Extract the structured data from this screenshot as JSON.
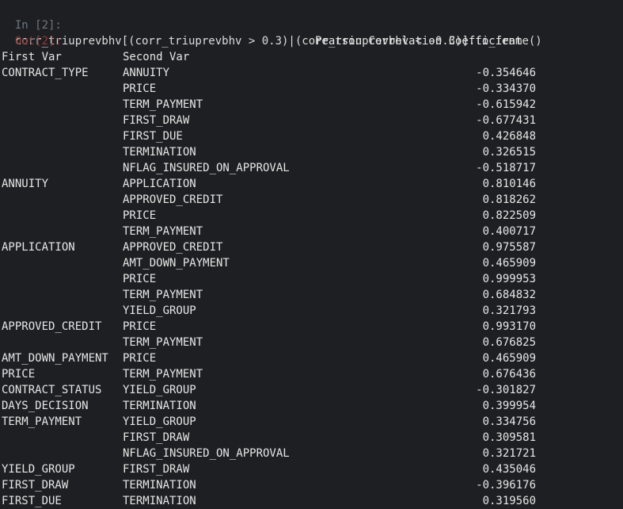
{
  "input": {
    "prompt": "In [2]:",
    "code": "corr_triuprevbhv[(corr_triuprevbhv > 0.3)|(corr_triuprevbhv < -0.3)].to_frame()"
  },
  "output": {
    "prompt": "Out[2]:",
    "column_header": "Pearson Correlation Coefficient",
    "index_headers": [
      "First Var",
      "Second Var"
    ],
    "rows": [
      {
        "first": "CONTRACT_TYPE",
        "second": "ANNUITY",
        "value": "-0.354646"
      },
      {
        "first": "",
        "second": "PRICE",
        "value": "-0.334370"
      },
      {
        "first": "",
        "second": "TERM_PAYMENT",
        "value": "-0.615942"
      },
      {
        "first": "",
        "second": "FIRST_DRAW",
        "value": "-0.677431"
      },
      {
        "first": "",
        "second": "FIRST_DUE",
        "value": "0.426848"
      },
      {
        "first": "",
        "second": "TERMINATION",
        "value": "0.326515"
      },
      {
        "first": "",
        "second": "NFLAG_INSURED_ON_APPROVAL",
        "value": "-0.518717"
      },
      {
        "first": "ANNUITY",
        "second": "APPLICATION",
        "value": "0.810146"
      },
      {
        "first": "",
        "second": "APPROVED_CREDIT",
        "value": "0.818262"
      },
      {
        "first": "",
        "second": "PRICE",
        "value": "0.822509"
      },
      {
        "first": "",
        "second": "TERM_PAYMENT",
        "value": "0.400717"
      },
      {
        "first": "APPLICATION",
        "second": "APPROVED_CREDIT",
        "value": "0.975587"
      },
      {
        "first": "",
        "second": "AMT_DOWN_PAYMENT",
        "value": "0.465909"
      },
      {
        "first": "",
        "second": "PRICE",
        "value": "0.999953"
      },
      {
        "first": "",
        "second": "TERM_PAYMENT",
        "value": "0.684832"
      },
      {
        "first": "",
        "second": "YIELD_GROUP",
        "value": "0.321793"
      },
      {
        "first": "APPROVED_CREDIT",
        "second": "PRICE",
        "value": "0.993170"
      },
      {
        "first": "",
        "second": "TERM_PAYMENT",
        "value": "0.676825"
      },
      {
        "first": "AMT_DOWN_PAYMENT",
        "second": "PRICE",
        "value": "0.465909"
      },
      {
        "first": "PRICE",
        "second": "TERM_PAYMENT",
        "value": "0.676436"
      },
      {
        "first": "CONTRACT_STATUS",
        "second": "YIELD_GROUP",
        "value": "-0.301827"
      },
      {
        "first": "DAYS_DECISION",
        "second": "TERMINATION",
        "value": "0.399954"
      },
      {
        "first": "TERM_PAYMENT",
        "second": "YIELD_GROUP",
        "value": "0.334756"
      },
      {
        "first": "",
        "second": "FIRST_DRAW",
        "value": "0.309581"
      },
      {
        "first": "",
        "second": "NFLAG_INSURED_ON_APPROVAL",
        "value": "0.321721"
      },
      {
        "first": "YIELD_GROUP",
        "second": "FIRST_DRAW",
        "value": "0.435046"
      },
      {
        "first": "FIRST_DRAW",
        "second": "TERMINATION",
        "value": "-0.396176"
      },
      {
        "first": "FIRST_DUE",
        "second": "TERMINATION",
        "value": "0.319560"
      }
    ]
  }
}
